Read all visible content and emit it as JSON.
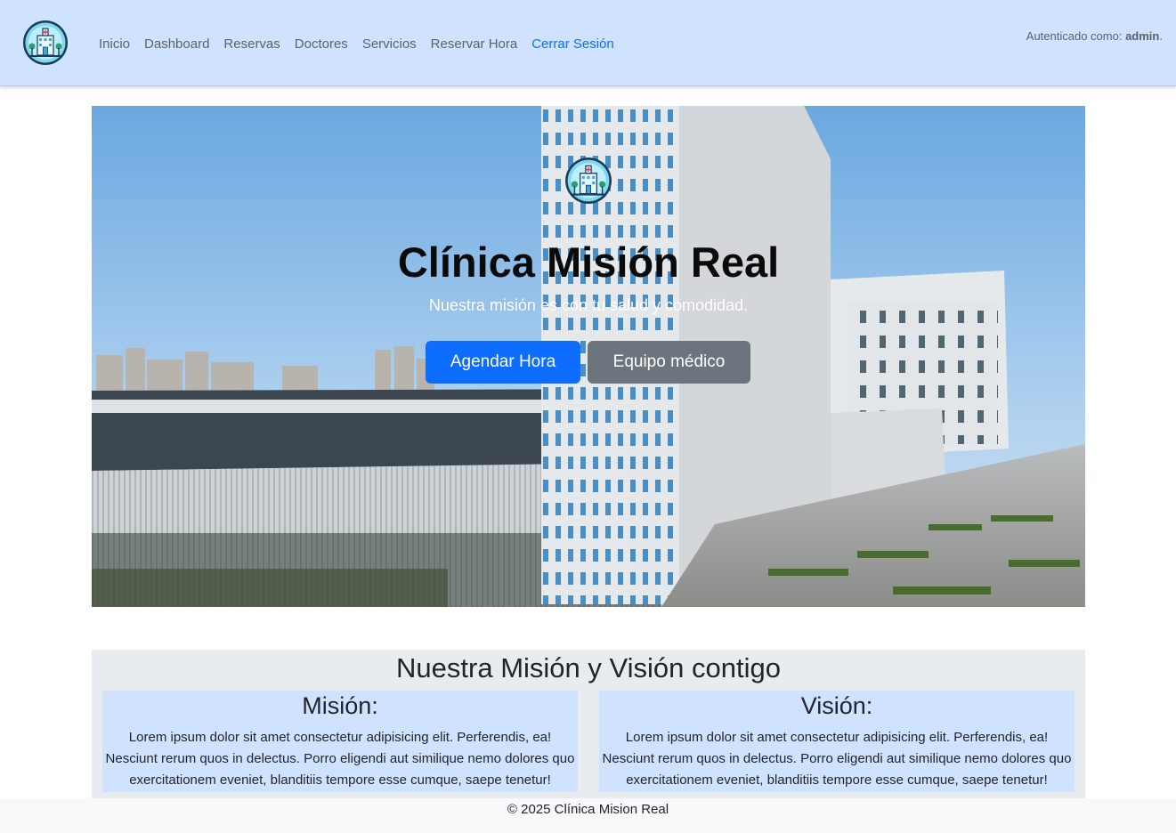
{
  "nav": {
    "links": [
      "Inicio",
      "Dashboard",
      "Reservas",
      "Doctores",
      "Servicios",
      "Reservar Hora"
    ],
    "logout": "Cerrar Sesión",
    "auth_prefix": "Autenticado como: ",
    "auth_user": "admin",
    "auth_suffix": "."
  },
  "hero": {
    "title": "Clínica Misión Real",
    "subtitle": "Nuestra misión es con tu salud y comodidad.",
    "primary_button": "Agendar Hora",
    "secondary_button": "Equipo médico"
  },
  "mission": {
    "title": "Nuestra Misión y Visión contigo",
    "mission_heading": "Misión:",
    "mission_text": "Lorem ipsum dolor sit amet consectetur adipisicing elit. Perferendis, ea! Nesciunt rerum quos in delectus. Porro eligendi aut similique nemo dolores quo exercitationem eveniet, blanditiis tempore esse cumque, saepe tenetur!",
    "vision_heading": "Visión:",
    "vision_text": "Lorem ipsum dolor sit amet consectetur adipisicing elit. Perferendis, ea! Nesciunt rerum quos in delectus. Porro eligendi aut similique nemo dolores quo exercitationem eveniet, blanditiis tempore esse cumque, saepe tenetur!"
  },
  "footer": {
    "text": "© 2025 Clínica Mision Real"
  },
  "colors": {
    "navbar_bg": "#cfe2ff",
    "primary": "#0d6efd",
    "secondary": "#6c757d",
    "section_bg": "#e9ecef"
  },
  "icons": {
    "logo": "hospital-logo-icon"
  }
}
